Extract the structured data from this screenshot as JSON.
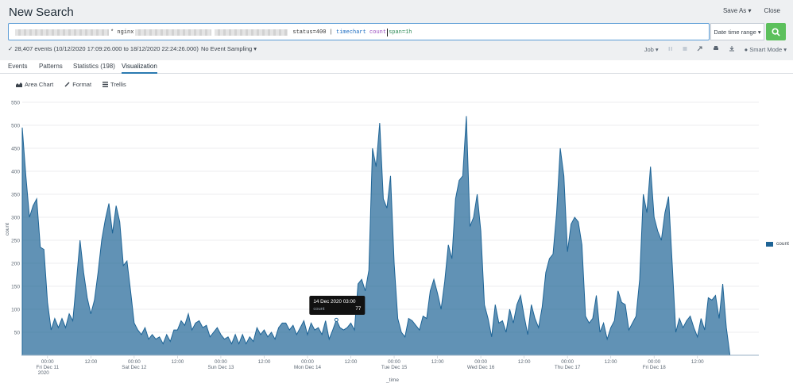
{
  "header": {
    "title": "New Search",
    "save_as": "Save As ▾",
    "close": "Close"
  },
  "search": {
    "part1": "* nginx",
    "part2": "status=400 |",
    "cmd": "timechart",
    "fn": "count",
    "arg": "span=1h",
    "time_picker": "Date time range ▾"
  },
  "status": {
    "events": "✓ 28,407 events (10/12/2020 17:09:26.000 to 18/12/2020 22:24:26.000)",
    "sampling": "No Event Sampling ▾",
    "job": "Job ▾",
    "smart_mode": "Smart Mode ▾"
  },
  "tabs": [
    "Events",
    "Patterns",
    "Statistics (198)",
    "Visualization"
  ],
  "viz_toolbar": {
    "area_chart": "Area Chart",
    "format": "Format",
    "trellis": "Trellis"
  },
  "tooltip": {
    "time": "14 Dec 2020 03:00",
    "label": "count",
    "value": "77"
  },
  "colors": {
    "area": "#1e6496",
    "search_button": "#5cc05c"
  },
  "chart_data": {
    "type": "area",
    "ylabel": "count",
    "xlabel": "_time",
    "ylim": [
      0,
      550
    ],
    "yticks": [
      50,
      100,
      150,
      200,
      250,
      300,
      350,
      400,
      450,
      500,
      550
    ],
    "legend": "count",
    "legend_position": "right",
    "x_start": "2020-12-10 17:00",
    "step": "1h",
    "x_ticks": [
      {
        "hours": 7,
        "label": "00:00",
        "sub": "Fri Dec 11",
        "sub2": "2020"
      },
      {
        "hours": 19,
        "label": "12:00"
      },
      {
        "hours": 31,
        "label": "00:00",
        "sub": "Sat Dec 12"
      },
      {
        "hours": 43,
        "label": "12:00"
      },
      {
        "hours": 55,
        "label": "00:00",
        "sub": "Sun Dec 13"
      },
      {
        "hours": 67,
        "label": "12:00"
      },
      {
        "hours": 79,
        "label": "00:00",
        "sub": "Mon Dec 14"
      },
      {
        "hours": 91,
        "label": "12:00"
      },
      {
        "hours": 103,
        "label": "00:00",
        "sub": "Tue Dec 15"
      },
      {
        "hours": 115,
        "label": "12:00"
      },
      {
        "hours": 127,
        "label": "00:00",
        "sub": "Wed Dec 16"
      },
      {
        "hours": 139,
        "label": "12:00"
      },
      {
        "hours": 151,
        "label": "00:00",
        "sub": "Thu Dec 17"
      },
      {
        "hours": 163,
        "label": "12:00"
      },
      {
        "hours": 175,
        "label": "00:00",
        "sub": "Fri Dec 18"
      },
      {
        "hours": 187,
        "label": "12:00"
      }
    ],
    "values": [
      495,
      390,
      300,
      325,
      340,
      235,
      230,
      115,
      55,
      80,
      60,
      80,
      60,
      90,
      75,
      160,
      250,
      180,
      125,
      90,
      120,
      180,
      250,
      295,
      330,
      265,
      325,
      290,
      195,
      205,
      140,
      70,
      55,
      45,
      60,
      35,
      45,
      35,
      40,
      25,
      45,
      30,
      55,
      55,
      75,
      65,
      90,
      55,
      70,
      75,
      60,
      65,
      40,
      50,
      60,
      45,
      35,
      40,
      25,
      45,
      25,
      45,
      25,
      40,
      30,
      60,
      45,
      55,
      40,
      50,
      35,
      60,
      70,
      70,
      55,
      65,
      45,
      60,
      75,
      45,
      70,
      55,
      60,
      45,
      75,
      35,
      55,
      77,
      60,
      55,
      60,
      70,
      55,
      155,
      165,
      140,
      185,
      450,
      410,
      505,
      340,
      320,
      390,
      200,
      80,
      50,
      40,
      80,
      75,
      65,
      55,
      85,
      80,
      140,
      165,
      135,
      100,
      160,
      240,
      210,
      340,
      380,
      390,
      520,
      280,
      300,
      350,
      270,
      110,
      80,
      40,
      110,
      70,
      75,
      50,
      100,
      70,
      110,
      130,
      85,
      45,
      110,
      80,
      60,
      105,
      180,
      210,
      220,
      310,
      450,
      390,
      225,
      285,
      300,
      290,
      240,
      85,
      70,
      80,
      130,
      50,
      70,
      35,
      60,
      75,
      140,
      115,
      110,
      55,
      70,
      85,
      165,
      350,
      310,
      410,
      300,
      270,
      250,
      310,
      345,
      200,
      50,
      80,
      60,
      75,
      85,
      60,
      40,
      80,
      55,
      125,
      120,
      130,
      80,
      155,
      60,
      0,
      0,
      0,
      0,
      0,
      0,
      0,
      0,
      0
    ]
  }
}
